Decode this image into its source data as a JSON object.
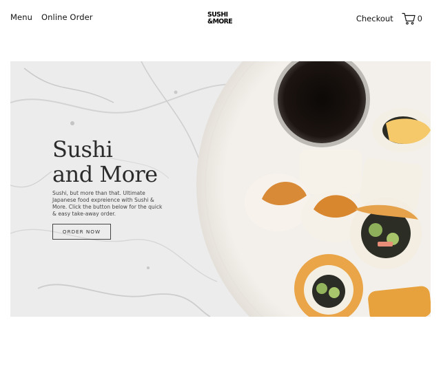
{
  "header": {
    "nav": [
      {
        "label": "Menu"
      },
      {
        "label": "Online Order"
      }
    ],
    "logo": {
      "line1": "SUSHI",
      "line2": "&MORE"
    },
    "checkout_label": "Checkout",
    "cart_count": "0",
    "icons": {
      "cart": "shopping-cart-icon"
    }
  },
  "hero": {
    "title_line1": "Sushi",
    "title_line2": "and More",
    "description": "Sushi, but more than that. Ultimate Japanese food expreience with Sushi & More. Click the button below for the quick & easy take-away order.",
    "button_label": "ORDER NOW",
    "image_alt": "Plate of sushi rolls with soy sauce on marble"
  },
  "colors": {
    "text": "#1a1a1a",
    "marble": "#ececec",
    "plate": "#f1eee9"
  }
}
